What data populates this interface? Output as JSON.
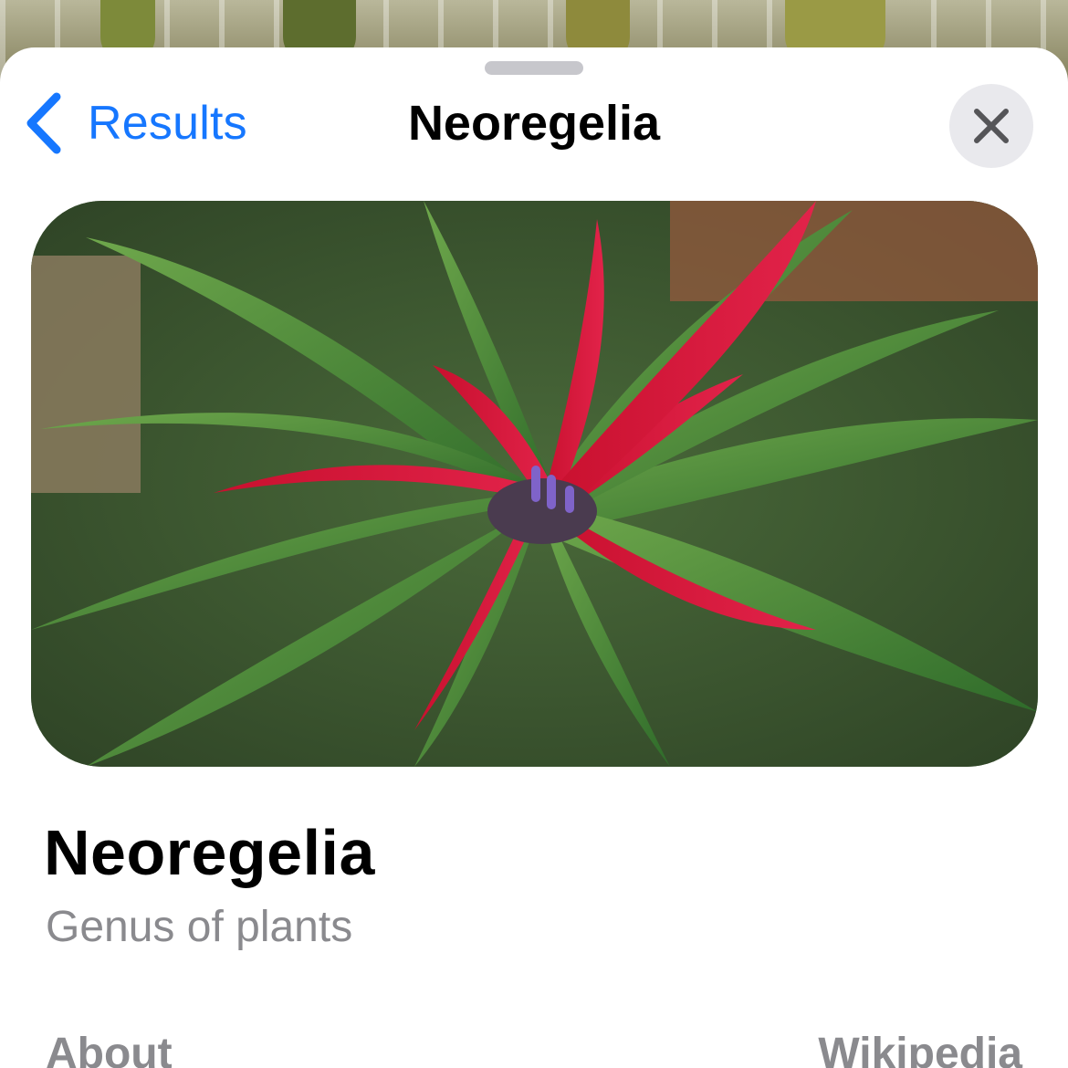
{
  "nav": {
    "back_label": "Results",
    "title": "Neoregelia"
  },
  "hero_image": {
    "description_icon": "plant-photo"
  },
  "content": {
    "title": "Neoregelia",
    "subtitle": "Genus of plants",
    "section_label": "About",
    "source_label": "Wikipedia"
  },
  "colors": {
    "accent": "#1677ff",
    "secondary_text": "#8a8a8e",
    "close_button_bg": "#e9e9ed"
  }
}
